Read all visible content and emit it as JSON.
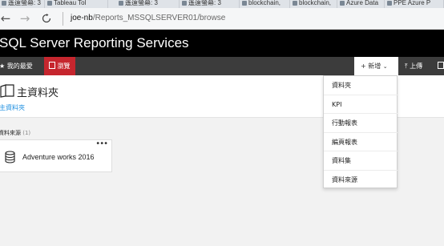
{
  "browser": {
    "tabs": [
      {
        "label": "遙遠螢幕: 3"
      },
      {
        "label": "Tableau Tol"
      },
      {
        "label": "遙遠螢幕: 3"
      },
      {
        "label": "遙遠螢幕: 3"
      },
      {
        "label": "blockchain,"
      },
      {
        "label": "blockchain,"
      },
      {
        "label": "Azure Data"
      },
      {
        "label": "PPE Azure P"
      }
    ],
    "url_host": "joe-nb",
    "url_path": "/Reports_MSSQLSERVER01/browse"
  },
  "app": {
    "brand": "SQL Server Reporting Services"
  },
  "toolbar": {
    "favorites_label": "我的最愛",
    "browse_label": "瀏覽",
    "new_label": "新增",
    "upload_label": "上傳"
  },
  "main": {
    "title": "主資料夾",
    "breadcrumb": "主資料夾",
    "section_label": "資料來源",
    "section_count": "(1)",
    "tiles": [
      {
        "label": "Adventure works 2016",
        "menu": "•••"
      }
    ]
  },
  "new_menu": {
    "items": [
      {
        "label": "資料夾"
      },
      {
        "label": "KPI"
      },
      {
        "label": "行動報表"
      },
      {
        "label": "編頁報表"
      },
      {
        "label": "資料集"
      },
      {
        "label": "資料來源"
      }
    ]
  }
}
